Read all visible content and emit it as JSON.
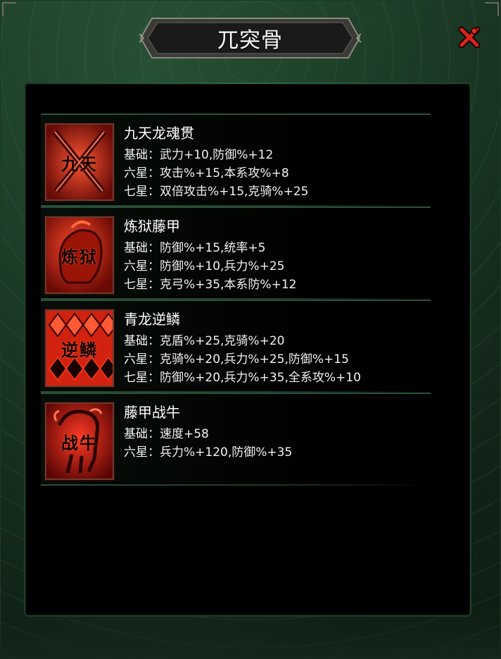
{
  "header": {
    "title": "兀突骨"
  },
  "close": {
    "icon": "close-icon"
  },
  "colors": {
    "accent": "#ff3a22",
    "panel_bg": "#000000",
    "frame_green": "#1d3f2a"
  },
  "items": [
    {
      "name": "九天龙魂贯",
      "icon_label": "九天",
      "icon": "crossed-swords-icon",
      "stats": [
        "基础：武力+10,防御%+12",
        "六星：攻击%+15,本系攻%+8",
        "七星：双倍攻击%+15,克骑%+25"
      ]
    },
    {
      "name": "炼狱藤甲",
      "icon_label": "炼狱",
      "icon": "helmet-icon",
      "stats": [
        "基础：防御%+15,统率+5",
        "六星：防御%+10,兵力%+25",
        "七星：克弓%+35,本系防%+12"
      ]
    },
    {
      "name": "青龙逆鳞",
      "icon_label": "逆鳞",
      "icon": "scale-armor-icon",
      "stats": [
        "基础：克盾%+25,克骑%+20",
        "六星：克骑%+20,兵力%+25,防御%+15",
        "七星：防御%+20,兵力%+35,全系攻%+10"
      ]
    },
    {
      "name": "藤甲战牛",
      "icon_label": "战牛",
      "icon": "war-ox-icon",
      "stats": [
        "基础：速度+58",
        "六星：兵力%+120,防御%+35"
      ]
    }
  ]
}
